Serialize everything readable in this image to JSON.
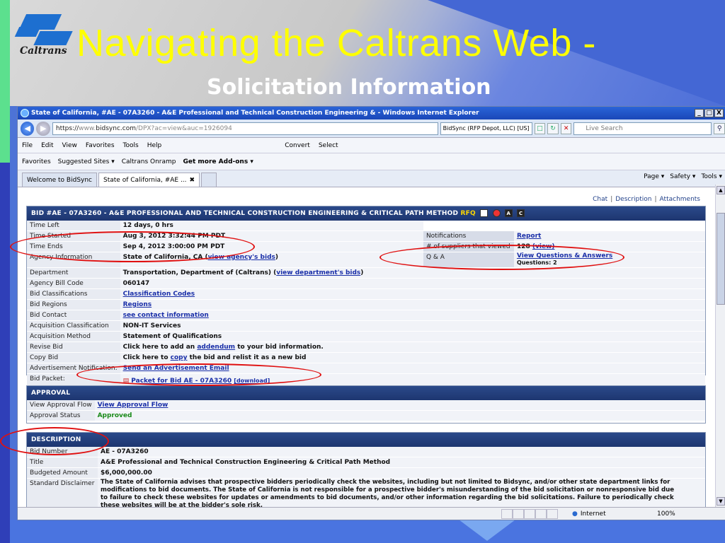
{
  "slide": {
    "title": "Navigating the Caltrans Web -",
    "subtitle": "Solicitation Information",
    "logo_text": "Caltrans"
  },
  "browser": {
    "window_title": "State of California, #AE - 07A3260 - A&E Professional and Technical Construction Engineering & - Windows Internet Explorer",
    "window_buttons": [
      "_",
      "□",
      "X"
    ],
    "address_prefix": "https://",
    "address_host": "www.",
    "address_domain": "bidsync.com",
    "address_path": "/DPX?ac=view&auc=1926094",
    "cert_label": "BidSync (RFP Depot, LLC) [US]",
    "search_placeholder": "Live Search",
    "menu": [
      "File",
      "Edit",
      "View",
      "Favorites",
      "Tools",
      "Help"
    ],
    "menu_right": [
      "Convert",
      "Select"
    ],
    "favorites_label": "Favorites",
    "favorites_items": [
      "Suggested Sites ▾",
      "Caltrans Onramp",
      "Get more Add-ons ▾"
    ],
    "tabs": [
      "Welcome to BidSync",
      "State of California, #AE ..."
    ],
    "commands": [
      "Page ▾",
      "Safety ▾",
      "Tools ▾"
    ],
    "status_zone": "Internet",
    "zoom": "100%"
  },
  "top_links": [
    "Chat",
    "Description",
    "Attachments"
  ],
  "bid_panel": {
    "header": "BID #AE - 07A3260 - A&E PROFESSIONAL AND TECHNICAL CONSTRUCTION ENGINEERING & CRITICAL PATH METHOD",
    "header_badge": "RFQ",
    "rows": {
      "time_left": {
        "label": "Time Left",
        "value": "12 days, 0 hrs"
      },
      "time_started": {
        "label": "Time Started",
        "value": "Aug 3, 2012 3:32:44 PM PDT"
      },
      "time_ends": {
        "label": "Time Ends",
        "value": "Sep 4, 2012 3:00:00 PM PDT"
      },
      "agency": {
        "label": "Agency Information",
        "value": "State of California, CA",
        "link": "view agency's bids"
      },
      "department": {
        "label": "Department",
        "value": "Transportation, Department of (Caltrans)",
        "link": "view department's bids"
      },
      "agency_bill_code": {
        "label": "Agency Bill Code",
        "value": "060147"
      },
      "bid_classifications": {
        "label": "Bid Classifications",
        "link": "Classification Codes"
      },
      "bid_regions": {
        "label": "Bid Regions",
        "link": "Regions"
      },
      "bid_contact": {
        "label": "Bid Contact",
        "link": "see contact information"
      },
      "acquisition_classification": {
        "label": "Acquisition Classification",
        "value": "NON-IT Services"
      },
      "acquisition_method": {
        "label": "Acquisition Method",
        "value": "Statement of Qualifications"
      },
      "revise_bid": {
        "label": "Revise Bid",
        "pre": "Click here to add an",
        "link": "addendum",
        "post": "to your bid information."
      },
      "copy_bid": {
        "label": "Copy Bid",
        "pre": "Click here to",
        "link": "copy",
        "post": "the bid and relist it as a new bid"
      },
      "ad_notification": {
        "label": "Advertisement Notification:",
        "link": "Send an Advertisement Email"
      },
      "bid_packet": {
        "label": "Bid Packet:",
        "link": "Packet for Bid AE - 07A3260",
        "download": "[download]"
      }
    },
    "right": {
      "notifications": {
        "label": "Notifications",
        "link": "Report"
      },
      "suppliers": {
        "label": "# of suppliers that viewed",
        "value": "128",
        "link": "(view)"
      },
      "qa": {
        "label": "Q & A",
        "link": "View Questions & Answers",
        "note": "Questions: 2"
      }
    }
  },
  "approval_panel": {
    "header": "APPROVAL",
    "rows": [
      {
        "label": "View Approval Flow",
        "link": "View Approval Flow"
      },
      {
        "label": "Approval Status",
        "value": "Approved"
      }
    ]
  },
  "description_panel": {
    "header": "DESCRIPTION",
    "rows": {
      "bid_number": {
        "label": "Bid Number",
        "value": "AE - 07A3260"
      },
      "title": {
        "label": "Title",
        "value": "A&E Professional and Technical Construction Engineering & Critical Path Method"
      },
      "budgeted_amount": {
        "label": "Budgeted Amount",
        "value": "$6,000,000.00"
      },
      "disclaimer": {
        "label": "Standard Disclaimer",
        "lines": [
          "The State of California advises that prospective bidders periodically check the websites, including but not limited to Bidsync, and/or other state department links for",
          "modifications to bid documents. The State of California is not responsible for a prospective bidder's misunderstanding of the bid solicitation or nonresponsive bid due",
          "to failure to check these websites for updates or amendments to bid documents, and/or other information regarding the bid solicitations. Failure to periodically check",
          "these websites will be at the bidder's sole risk."
        ]
      }
    }
  },
  "colors": {
    "title_yellow": "#ffff00",
    "panel_header": "#1d3670",
    "annotation_red": "#e01010",
    "link_blue": "#1a2fa8"
  }
}
